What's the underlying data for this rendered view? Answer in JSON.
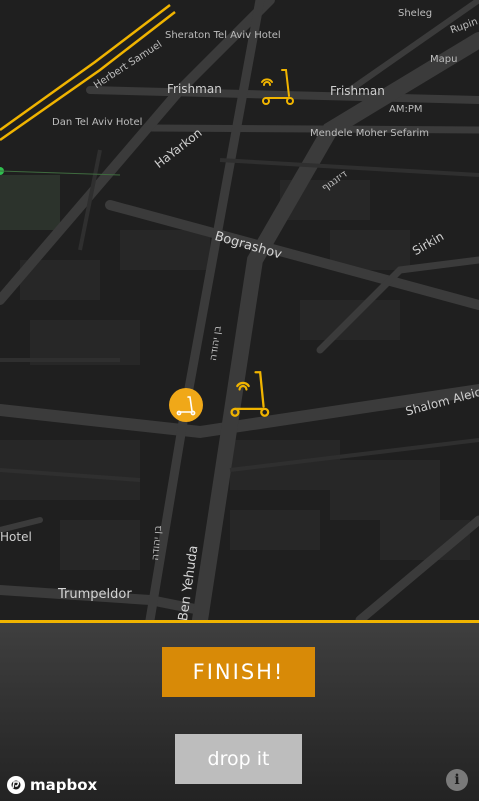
{
  "map": {
    "street_labels": {
      "herbert_samuel": "Herbert Samuel",
      "sheraton": "Sheraton Tel Aviv Hotel",
      "sheleg": "Sheleg",
      "rupin": "Rupin",
      "mapu": "Mapu",
      "frishman_left": "Frishman",
      "frishman_right": "Frishman",
      "ampm": "AM:PM",
      "dan_hotel": "Dan Tel Aviv Hotel",
      "hayarkon": "HaYarkon",
      "mendele": "Mendele Moher Sefarim",
      "hebrew_top": "דיזנגוף",
      "bograshov": "Bograshov",
      "sirkin": "Sirkin",
      "hebrew_mid": "בן יהודה",
      "shalom_aleichem": "Shalom Aleichem",
      "hotel": "Hotel",
      "hebrew_low": "בן יהודה",
      "trumpeldor": "Trumpeldor",
      "ben_yehuda": "Ben Yehuda"
    },
    "markers": {
      "scooter_icon": "scooter-icon",
      "user_location_icon": "user-location-icon",
      "accent_color": "#f0b400"
    }
  },
  "actions": {
    "finish_label": "FINISH!",
    "drop_label": "drop it"
  },
  "footer": {
    "logo_text": "mapbox",
    "info_symbol": "i"
  },
  "colors": {
    "finish_bg": "#d88a07",
    "drop_bg": "#bdbdbd",
    "panel_border": "#f0b400"
  }
}
